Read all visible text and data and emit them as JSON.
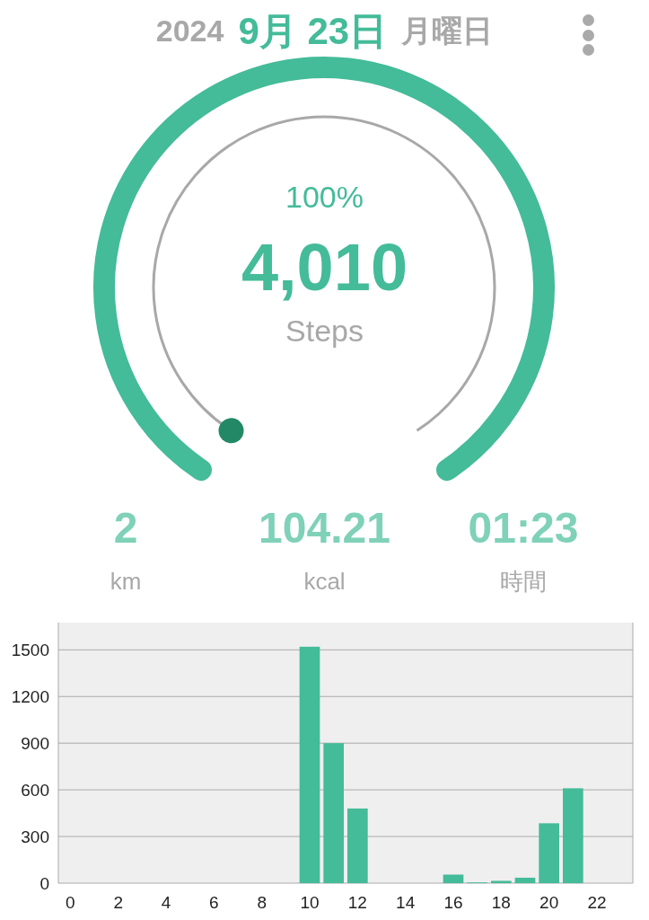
{
  "header": {
    "year": "2024",
    "month_day": "9月 23日",
    "weekday": "月曜日"
  },
  "gauge": {
    "percent": "100%",
    "steps": "4,010",
    "unit": "Steps"
  },
  "stats": [
    {
      "value": "2",
      "unit": "km"
    },
    {
      "value": "104.21",
      "unit": "kcal"
    },
    {
      "value": "01:23",
      "unit": "時間"
    }
  ],
  "chart": {
    "chart_data": {
      "type": "bar",
      "xlim": [
        -0.5,
        23.5
      ],
      "x": [
        0,
        1,
        2,
        3,
        4,
        5,
        6,
        7,
        8,
        9,
        10,
        11,
        12,
        13,
        14,
        15,
        16,
        17,
        18,
        19,
        20,
        21,
        22,
        23
      ],
      "grid": true,
      "series": [
        {
          "color": "#44bb99",
          "values": [
            0,
            0,
            0,
            0,
            0,
            0,
            0,
            0,
            0,
            0,
            1520,
            900,
            480,
            0,
            0,
            0,
            55,
            5,
            15,
            35,
            385,
            610,
            0,
            0
          ]
        }
      ],
      "ylim": [
        0,
        1675
      ],
      "yticks": [
        0,
        300,
        600,
        900,
        1200,
        1500
      ],
      "xticks": [
        0,
        2,
        4,
        6,
        8,
        10,
        12,
        14,
        16,
        18,
        20,
        22
      ]
    }
  }
}
